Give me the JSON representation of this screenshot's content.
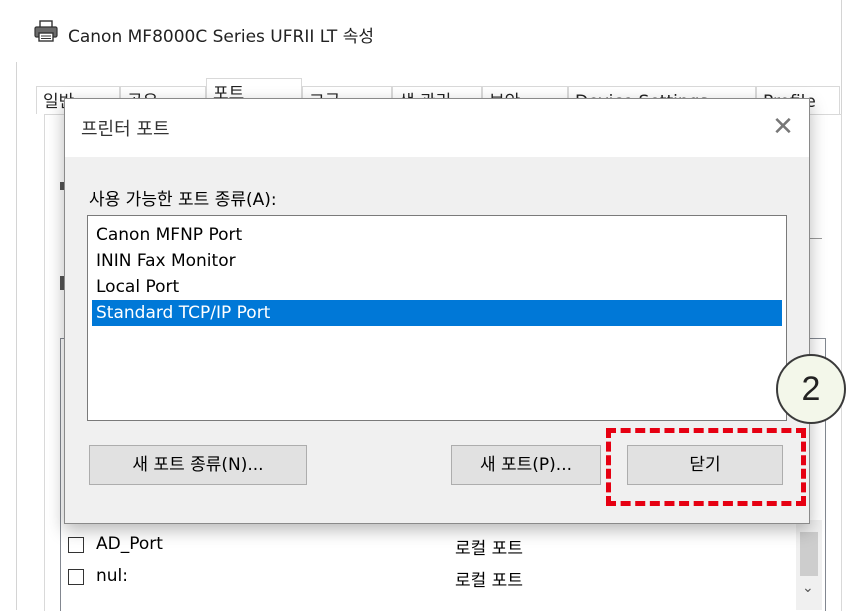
{
  "window": {
    "title": "Canon MF8000C Series UFRII LT 속성",
    "tabs": [
      "일반",
      "공유",
      "포트",
      "고급",
      "색 관리",
      "보안",
      "Device Settings",
      "Profile"
    ]
  },
  "background_ports": [
    {
      "port": "AD_Port",
      "description": "로컬 포트"
    },
    {
      "port": "nul:",
      "description": "로컬 포트"
    }
  ],
  "dialog": {
    "title": "프린터 포트",
    "close_glyph": "✕",
    "available_label": "사용 가능한 포트 종류(A):",
    "port_types": [
      "Canon MFNP Port",
      "ININ Fax Monitor",
      "Local Port",
      "Standard TCP/IP Port"
    ],
    "selected_index": 3,
    "buttons": {
      "new_port_type": "새 포트 종류(N)...",
      "new_port": "새 포트(P)...",
      "close": "닫기"
    }
  },
  "callout": {
    "number": "2",
    "accent_color": "#e60012"
  },
  "colors": {
    "selection": "#0078d7"
  }
}
